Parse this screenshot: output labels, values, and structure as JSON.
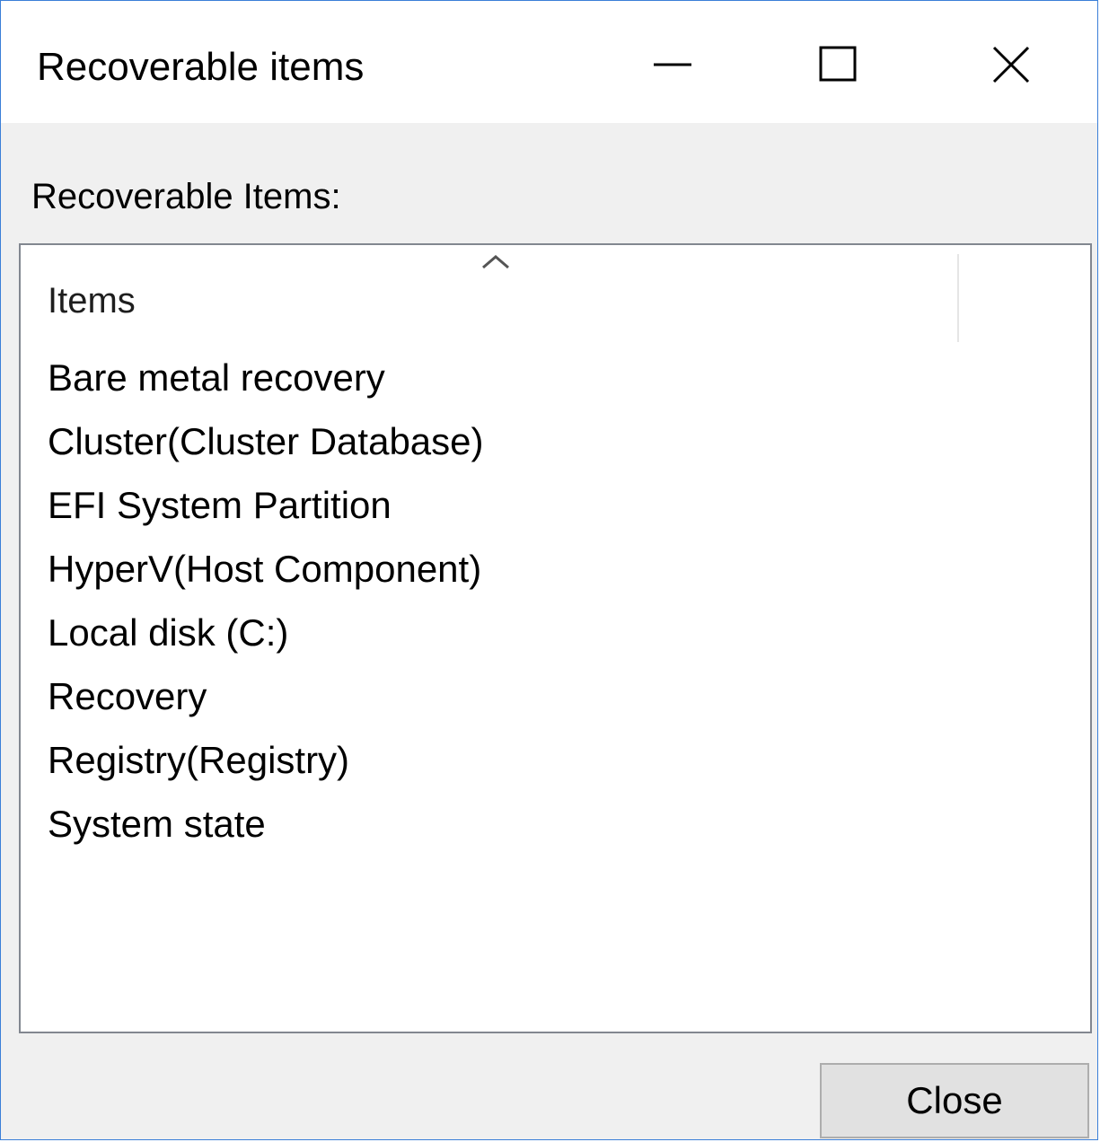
{
  "window": {
    "title": "Recoverable items",
    "controls": {
      "minimize": "minimize-icon",
      "maximize": "maximize-icon",
      "close": "close-icon"
    }
  },
  "group": {
    "label": "Recoverable Items:"
  },
  "list": {
    "column_header": "Items",
    "sort_icon": "chevron-up-icon",
    "items": [
      "Bare metal recovery",
      "Cluster(Cluster Database)",
      "EFI System Partition",
      "HyperV(Host Component)",
      "Local disk (C:)",
      "Recovery",
      "Registry(Registry)",
      "System state"
    ]
  },
  "footer": {
    "close_label": "Close"
  },
  "colors": {
    "window_border": "#3b7fd8",
    "dialog_background": "#f0f0f0",
    "list_border": "#828790",
    "button_background": "#e1e1e1",
    "button_border": "#adadad"
  }
}
